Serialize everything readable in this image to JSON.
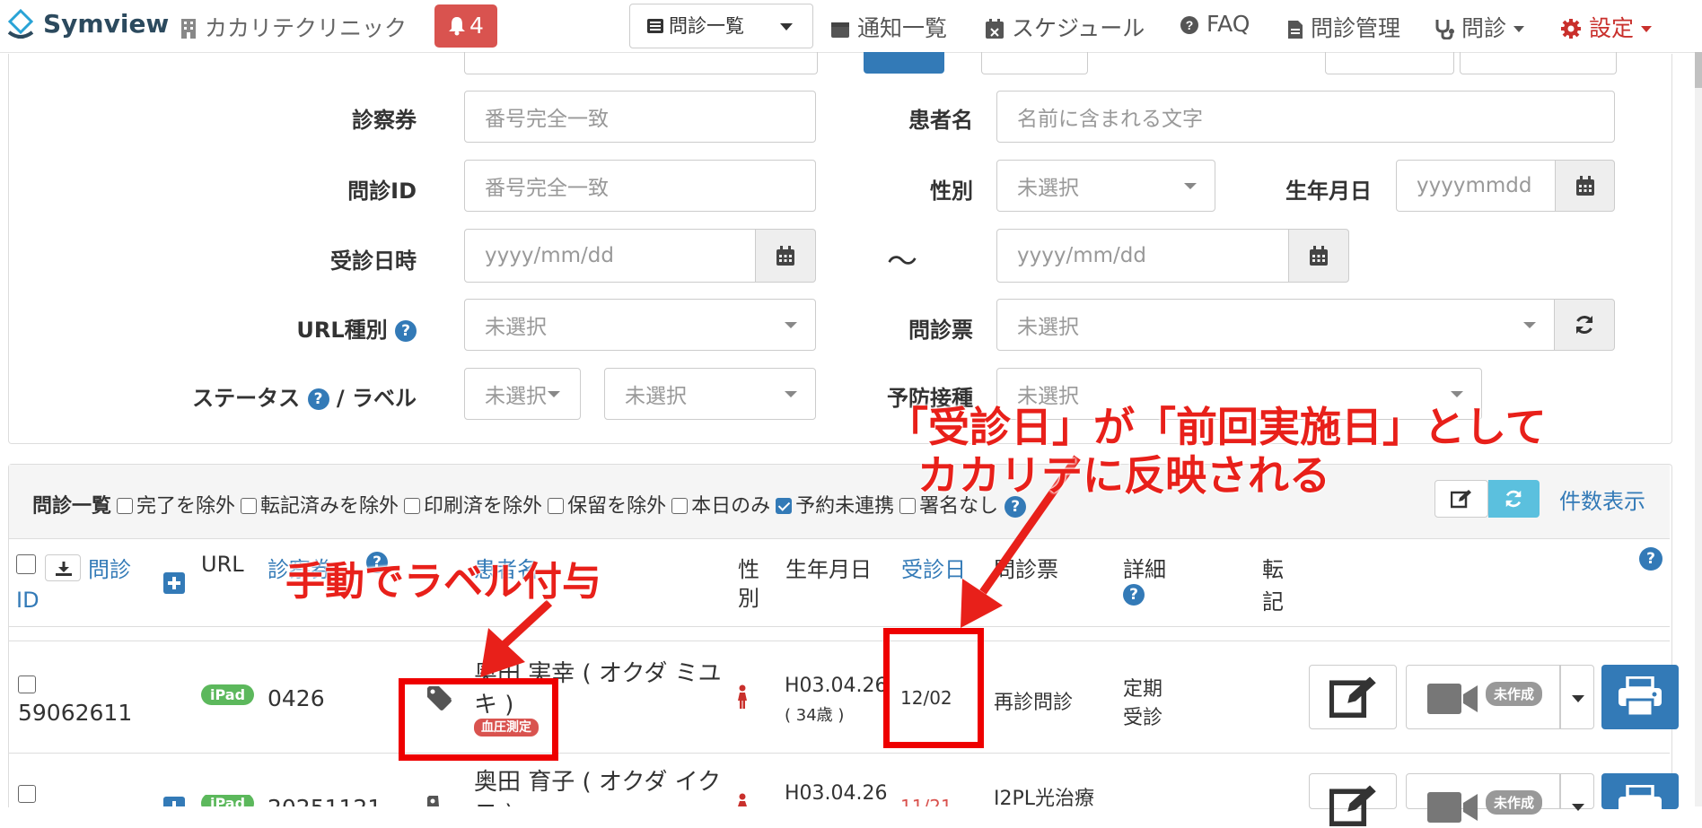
{
  "navbar": {
    "brand": "Symview",
    "clinic": "カカリテクリニック",
    "notification_count": "4",
    "list_dropdown": "問診一覧",
    "links": {
      "notices": "通知一覧",
      "schedule": "スケジュール",
      "faq": "FAQ",
      "management": "問診管理",
      "interview": "問診",
      "settings": "設定"
    }
  },
  "search": {
    "card_no_label": "診察券",
    "card_no_placeholder": "番号完全一致",
    "patient_name_label": "患者名",
    "patient_name_placeholder": "名前に含まれる文字",
    "interview_id_label": "問診ID",
    "interview_id_placeholder": "番号完全一致",
    "gender_label": "性別",
    "gender_value": "未選択",
    "birthdate_label": "生年月日",
    "birthdate_placeholder": "yyyymmdd",
    "visit_datetime_label": "受診日時",
    "date_from_placeholder": "yyyy/mm/dd",
    "range_separator": "〜",
    "date_to_placeholder": "yyyy/mm/dd",
    "url_type_label": "URL種別",
    "url_type_value": "未選択",
    "form_label": "問診票",
    "form_value": "未選択",
    "status_label": "ステータス",
    "label_label": "ラベル",
    "slash": "/",
    "status_value": "未選択",
    "label_value": "未選択",
    "vaccination_label": "予防接種",
    "vaccination_value": "未選択"
  },
  "list": {
    "title": "問診一覧",
    "filters": [
      {
        "label": "完了を除外",
        "checked": false
      },
      {
        "label": "転記済みを除外",
        "checked": false
      },
      {
        "label": "印刷済を除外",
        "checked": false
      },
      {
        "label": "保留を除外",
        "checked": false
      },
      {
        "label": "本日のみ",
        "checked": false
      },
      {
        "label": "予約未連携",
        "checked": true
      },
      {
        "label": "署名なし",
        "checked": false
      }
    ],
    "count_link": "件数表示",
    "columns": {
      "id_1": "問診",
      "id_2": "ID",
      "url": "URL",
      "card": "診察券",
      "patient": "患者名",
      "gender_1": "性",
      "gender_2": "別",
      "birth": "生年月日",
      "visit": "受診日",
      "form": "問診票",
      "detail": "詳細",
      "trans_1": "転",
      "trans_2": "記"
    },
    "rows": [
      {
        "id": "59062611",
        "url": "iPad",
        "card": "0426",
        "name_1": "奥田 実幸 ( オクダ ミユ",
        "name_2": "キ )",
        "badge": "血圧測定",
        "birth": "H03.04.26",
        "age": "( 34歳 )",
        "visit": "12/02",
        "form": "再診問診",
        "detail_1": "定期",
        "detail_2": "受診",
        "video_badge": "未作成"
      },
      {
        "id": "",
        "url": "iPad",
        "card": "20251121",
        "name_1": "奥田 育子 ( オクダ イク",
        "name_2": "コ )",
        "birth": "H03.04.26",
        "visit": "11/21",
        "form": "I2PL光治療",
        "video_badge": "未作成"
      }
    ]
  },
  "annotations": {
    "manual_label": "手動でラベル付与",
    "visit_line1": "「受診日」が「前回実施日」として",
    "visit_line2": "カカリテに反映される"
  },
  "colors": {
    "primary": "#337ab7",
    "danger": "#d9534f",
    "success": "#5cb85c",
    "annotation": "#e8201a"
  }
}
